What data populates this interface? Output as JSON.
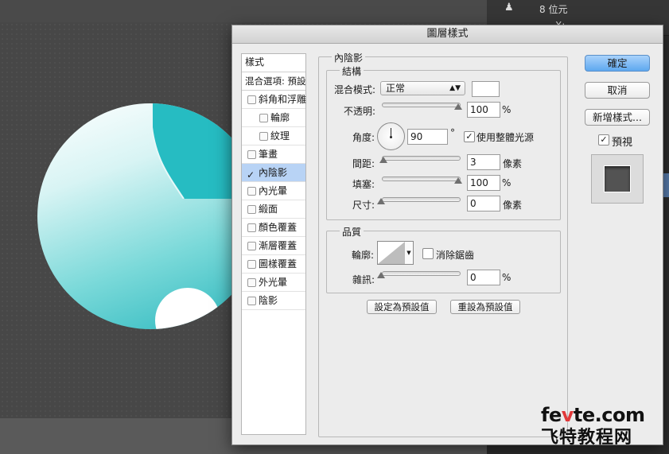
{
  "right_panel": {
    "row1_label": "8 位元",
    "row2_label": "X:"
  },
  "watermark": {
    "line1_a": "fe",
    "line1_b": "v",
    "line1_c": "te.com",
    "line2": "飞特教程网"
  },
  "dialog": {
    "title": "圖層樣式",
    "style_list": {
      "header": "樣式",
      "blend": "混合選項: 預設",
      "items": [
        {
          "label": "斜角和浮雕",
          "checked": false
        },
        {
          "label": "輪廓",
          "checked": false,
          "indent": true
        },
        {
          "label": "紋理",
          "checked": false,
          "indent": true
        },
        {
          "label": "筆畫",
          "checked": false
        },
        {
          "label": "內陰影",
          "checked": true
        },
        {
          "label": "內光暈",
          "checked": false
        },
        {
          "label": "緞面",
          "checked": false
        },
        {
          "label": "顏色覆蓋",
          "checked": false
        },
        {
          "label": "漸層覆蓋",
          "checked": false
        },
        {
          "label": "圖樣覆蓋",
          "checked": false
        },
        {
          "label": "外光暈",
          "checked": false
        },
        {
          "label": "陰影",
          "checked": false
        }
      ],
      "check_mark": "✓"
    },
    "inner_shadow": {
      "section_title": "內陰影",
      "structure": {
        "title": "結構",
        "blend_mode_label": "混合模式:",
        "blend_mode_value": "正常",
        "opacity_label": "不透明:",
        "opacity_value": "100",
        "opacity_unit": "%",
        "opacity_level": 1.0,
        "angle_label": "角度:",
        "angle_value": "90",
        "angle_unit": "°",
        "global_light_label": "使用整體光源",
        "global_light_checked": true,
        "distance_label": "間距:",
        "distance_value": "3",
        "distance_unit": "像素",
        "choke_label": "填塞:",
        "choke_value": "100",
        "choke_unit": "%",
        "size_label": "尺寸:",
        "size_value": "0",
        "size_unit": "像素"
      },
      "quality": {
        "title": "品質",
        "contour_label": "輪廓:",
        "antialias_label": "消除鋸齒",
        "antialias_checked": false,
        "noise_label": "雜訊:",
        "noise_value": "0",
        "noise_unit": "%"
      },
      "make_default": "設定為預設值",
      "reset_default": "重設為預設值"
    },
    "buttons": {
      "ok": "確定",
      "cancel": "取消",
      "new_style": "新增樣式...",
      "preview_label": "預視",
      "preview_checked": true
    }
  },
  "colors": {
    "accent_teal": "#2ab7bd",
    "selection": "#b8d3f5",
    "primary_button": "#5ea8ef",
    "watermark_red": "#e0393a"
  }
}
